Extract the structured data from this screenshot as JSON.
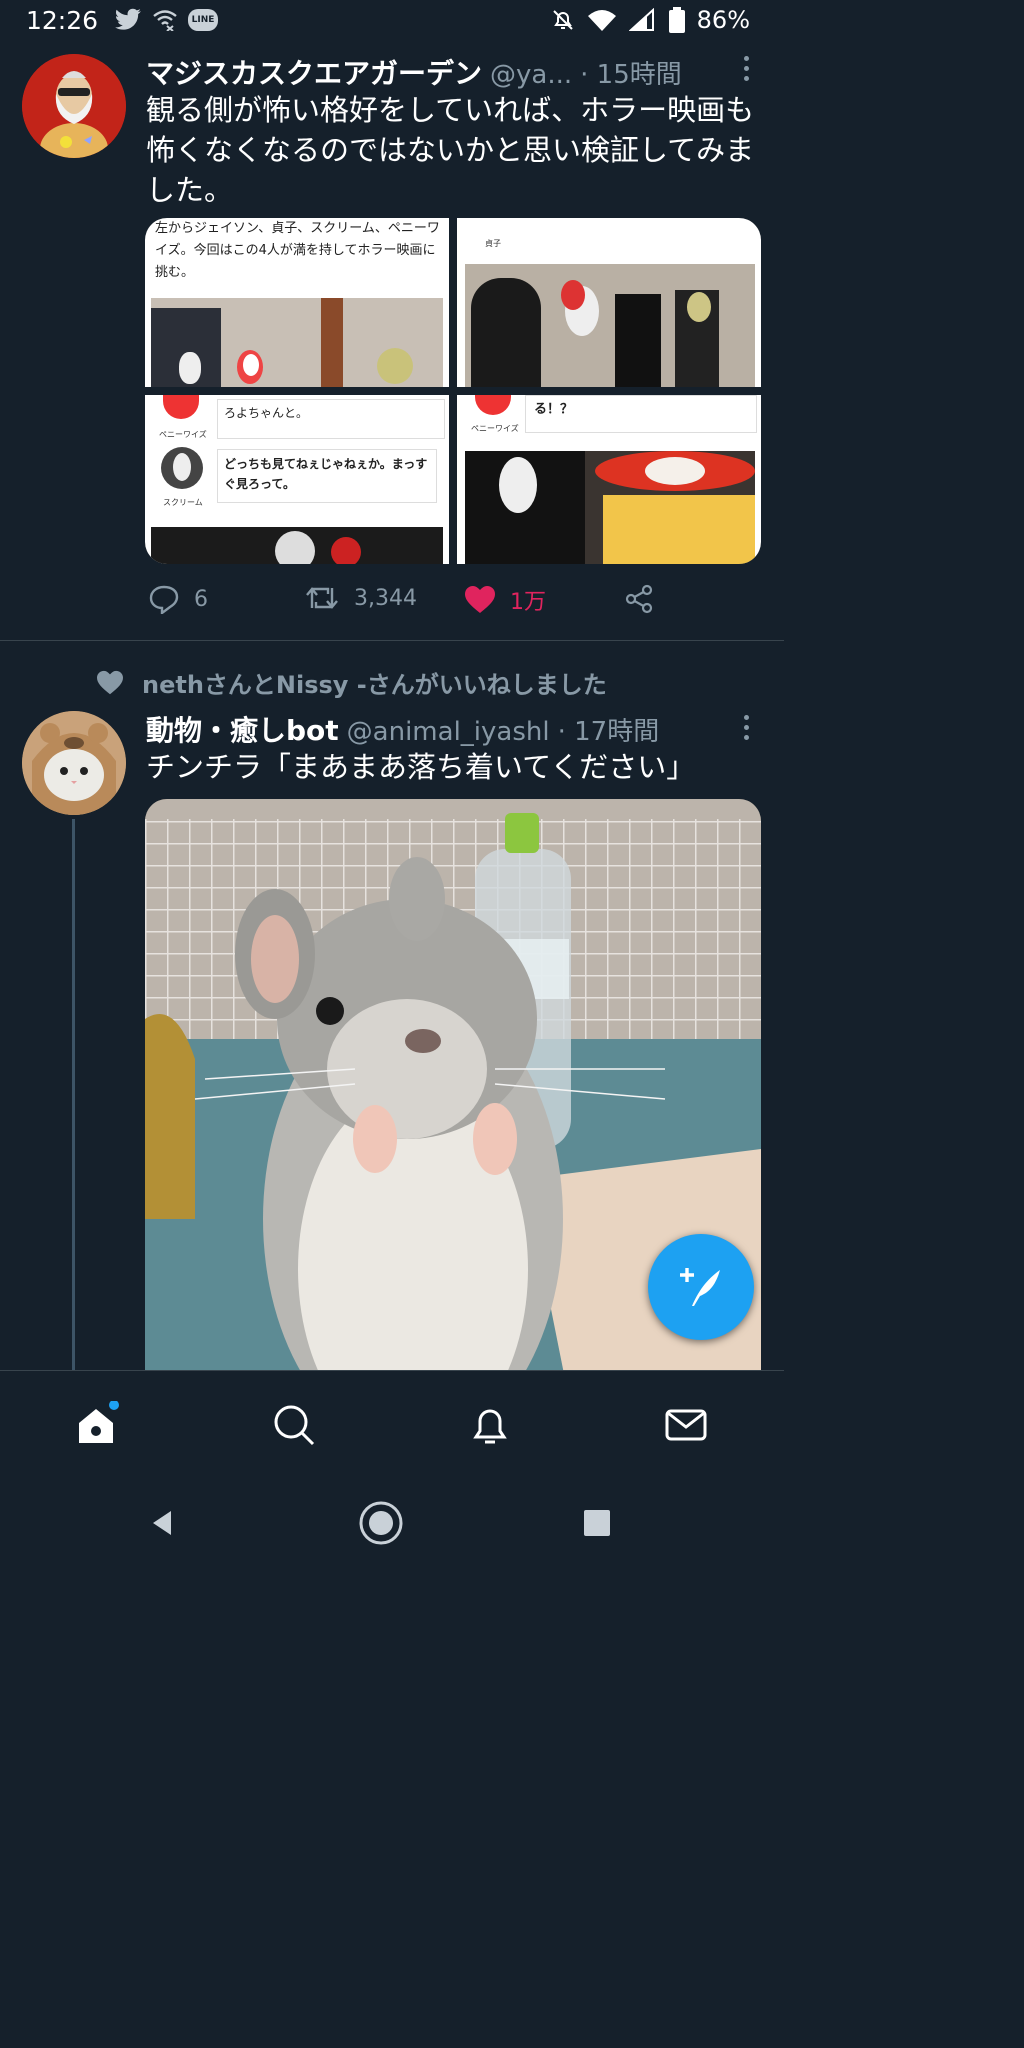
{
  "status_bar": {
    "time": "12:26",
    "battery": "86%",
    "line_badge": "LINE"
  },
  "tweets": [
    {
      "name": "マジスカスクエアガーデン",
      "handle": "@ya...",
      "time": "· 15時間",
      "text": "観る側が怖い格好をしていれば、ホラー映画も怖くなくなるのではないかと思い検証してみました。",
      "media": {
        "img1_text": "左からジェイソン、貞子、スクリーム、ペニーワイズ。今回はこの4人が満を持してホラー映画に挑む。",
        "img2_caption": "貞子",
        "img3_text_top": "ろよちゃんと。",
        "img3_label_top": "ペニーワイズ",
        "img3_text_bottom": "どっちも見てねぇじゃねぇか。まっすぐ見ろって。",
        "img3_label_bottom": "スクリーム",
        "img4_text": "る！？",
        "img4_label": "ペニーワイズ"
      },
      "replies": "6",
      "retweets": "3,344",
      "likes": "1万"
    },
    {
      "liked_by": "nethさんとNissy -さんがいいねしました",
      "name": "動物・癒しbot",
      "handle": "@animal_iyashl",
      "time": "· 17時間",
      "text": "チンチラ「まあまあ落ち着いてください」"
    }
  ],
  "colors": {
    "background": "#15202b",
    "secondary_text": "#8899a6",
    "accent": "#1da1f2",
    "like": "#e0245e"
  }
}
